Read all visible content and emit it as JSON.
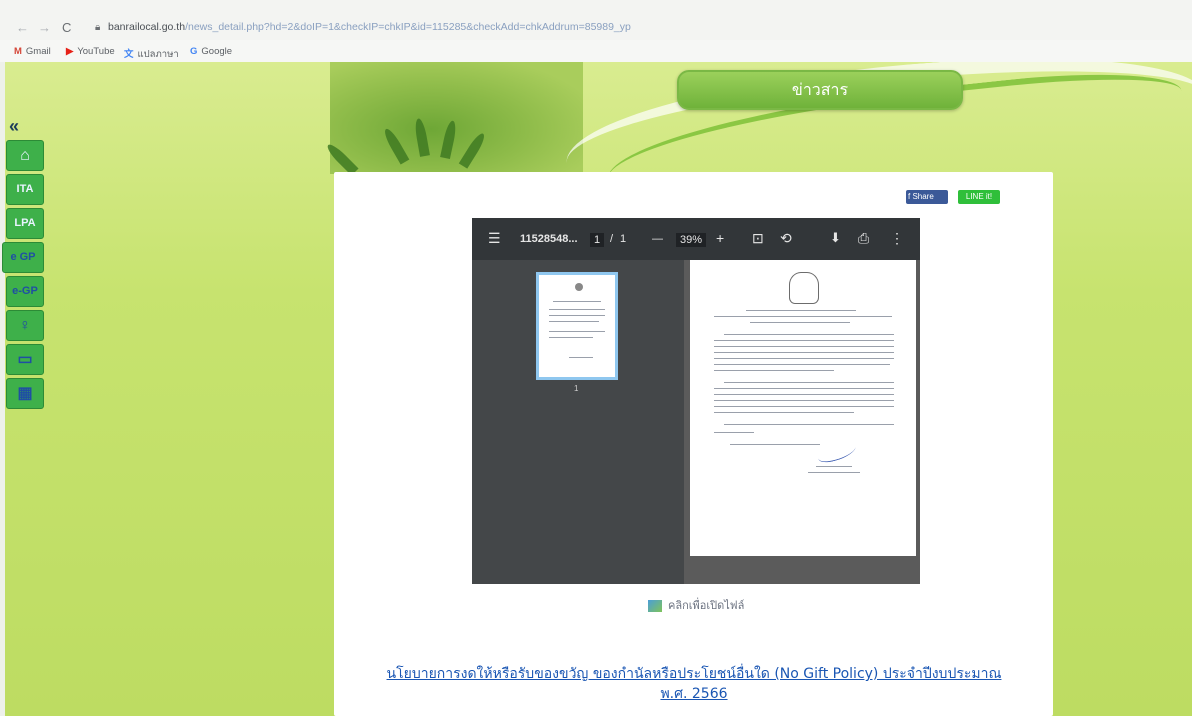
{
  "browser": {
    "nav_back": "←",
    "nav_forward": "→",
    "reload": "C",
    "url_host": "banrailocal.go.th",
    "url_path": "/news_detail.php?hd=2&doIP=1&checkIP=chkIP&id=115285&checkAdd=chkAddrum=85989_yp",
    "bookmarks": [
      {
        "icon": "M",
        "label": "Gmail",
        "color": "#d44638"
      },
      {
        "icon": "▶",
        "label": "YouTube",
        "color": "#e62117"
      },
      {
        "icon": "文",
        "label": "แปลภาษา",
        "color": "#4285f4"
      },
      {
        "icon": "G",
        "label": "Google",
        "color": "#4285f4"
      }
    ]
  },
  "header": {
    "news_tab_label": "ข่าวสาร"
  },
  "sidebar": {
    "collapse_label": "«",
    "items": [
      {
        "label": "⌂",
        "icon": "home-icon"
      },
      {
        "label": "ITA",
        "icon": "ita"
      },
      {
        "label": "LPA",
        "icon": "lpa"
      },
      {
        "label": "e GP",
        "icon": "egp"
      },
      {
        "label": "e-GP",
        "icon": "egp-globe-icon"
      },
      {
        "label": "♀",
        "icon": "person-icon"
      },
      {
        "label": "▭",
        "icon": "monitor-icon"
      },
      {
        "label": "▦",
        "icon": "directory-icon"
      }
    ]
  },
  "share": {
    "facebook_label": "f Share",
    "line_label": "LINE it!"
  },
  "pdf_viewer": {
    "menu_icon": "☰",
    "file_name": "11528548...",
    "page_current": "1",
    "page_sep": "/",
    "page_total": "1",
    "zoom_out": "—",
    "zoom": "39%",
    "zoom_in": "+",
    "fit_icon": "⊡",
    "rotate_icon": "⟲",
    "download_icon": "⬇",
    "print_icon": "⎙",
    "more_icon": "⋮",
    "thumb_page_number": "1"
  },
  "file_link_label": "คลิกเพื่อเปิดไฟล์",
  "news_title": "นโยบายการงดให้หรือรับของขวัญ ของกำนัลหรือประโยชน์อื่นใด (No Gift Policy) ประจำปีงบประมาณ พ.ศ. 2566",
  "colors": {
    "sidebar_button": "#3eb04a",
    "news_tab": "#6fb23a",
    "link": "#1a56b3",
    "pdf_toolbar": "#323639"
  }
}
